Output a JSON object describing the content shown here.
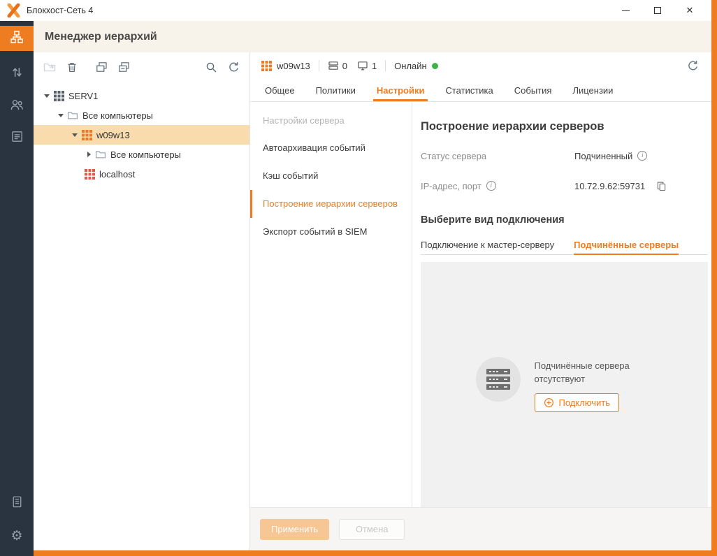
{
  "colors": {
    "accent": "#ee7d22",
    "rail_bg": "#2a3441",
    "selected_row": "#f8dcae",
    "status_online": "#3fb24a",
    "page_header_bg": "#f8f3ea"
  },
  "icons": {
    "close": "✕",
    "gear": "⚙"
  },
  "titlebar": {
    "app_title": "Блокхост-Сеть 4"
  },
  "page_header": {
    "title": "Менеджер иерархий"
  },
  "tree_panel": {
    "toolbar_icons": [
      "add-to-group",
      "delete",
      "expand-all",
      "collapse-all",
      "search",
      "refresh"
    ],
    "items": [
      {
        "label": "SERV1",
        "level": 0,
        "icon": "server-grid-dark",
        "expanded": true
      },
      {
        "label": "Все компьютеры",
        "level": 1,
        "icon": "folder",
        "expanded": true
      },
      {
        "label": "w09w13",
        "level": 2,
        "icon": "server-grid-orange",
        "expanded": true,
        "selected": true
      },
      {
        "label": "Все компьютеры",
        "level": 3,
        "icon": "folder",
        "expanded": false
      },
      {
        "label": "localhost",
        "level": 3,
        "icon": "server-grid-red",
        "expanded": false
      }
    ],
    "selected": "w09w13"
  },
  "server_bar": {
    "name": "w09w13",
    "servers_count": "0",
    "computers_count": "1",
    "status": "Онлайн"
  },
  "tabs": {
    "items": [
      "Общее",
      "Политики",
      "Настройки",
      "Статистика",
      "События",
      "Лицензии"
    ],
    "active": "Настройки"
  },
  "settings_nav": {
    "group_title": "Настройки сервера",
    "items": [
      "Автоархивация событий",
      "Кэш событий",
      "Построение иерархии серверов",
      "Экспорт событий в SIEM"
    ],
    "active": "Построение иерархии серверов"
  },
  "content": {
    "title": "Построение иерархии серверов",
    "fields": [
      {
        "label": "Статус сервера",
        "value": "Подчиненный"
      },
      {
        "label": "IP-адрес, порт",
        "value": "10.72.9.62:59731"
      }
    ],
    "choose_title": "Выберите вид подключения",
    "connection_tabs": [
      "Подключение к мастер-серверу",
      "Подчинённые серверы"
    ],
    "active_connection_tab": "Подчинённые серверы",
    "empty_text": "Подчинённые сервера отсутствуют",
    "connect_button": "Подключить"
  },
  "footer": {
    "apply": "Применить",
    "cancel": "Отмена"
  }
}
